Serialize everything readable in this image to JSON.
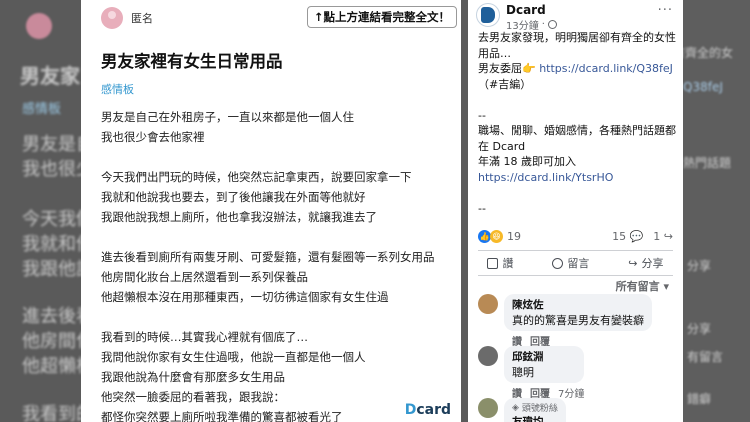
{
  "background": {
    "left_lines": [
      "男友家",
      "感情板",
      "男友是自",
      "我也很少",
      "今天我們",
      "我就和他",
      "我跟他說",
      "進去後看",
      "他房間化",
      "他超懶根",
      "我看到的"
    ],
    "right_lines": [
      "有齊全的女",
      "Q38feJ",
      "熱門話題",
      "分享",
      "分享",
      "有留言",
      "錯癖"
    ]
  },
  "article": {
    "author": "匿名",
    "notice": "↑點上方連結看完整全文！",
    "title": "男友家裡有女生日常用品",
    "tag": "感情板",
    "lines": [
      "男友是自己在外租房子，一直以來都是他一個人住",
      "我也很少會去他家裡",
      "",
      "今天我們出門玩的時候，他突然忘記拿東西，說要回家拿一下",
      "我就和他說我也要去，到了後他讓我在外面等他就好",
      "我跟他說我想上廁所，他也拿我沒辦法，就讓我進去了",
      "",
      "進去後看到廁所有兩隻牙刷、可愛髮箍，還有髮圈等一系列女用品",
      "他房間化妝台上居然還看到一系列保養品",
      "他超懶根本沒在用那種東西，一切彷彿這個家有女生住過",
      "",
      "我看到的時候…其實我心裡就有個底了…",
      "我問他說你家有女生住過哦，他說一直都是他一個人",
      "我跟他說為什麼會有那麼多女生用品",
      "他突然一臉委屈的看著我，跟我說：",
      "都怪你突然要上廁所啦我準備的驚喜都被看光了"
    ],
    "logo_d": "D",
    "logo_rest": "card"
  },
  "post": {
    "page_name": "Dcard",
    "time": "13分鐘",
    "more": "···",
    "text_lines": [
      "去男友家發現，明明獨居卻有齊全的女性用品…",
      "男友委屈👉 https://dcard.link/Q38feJ",
      "（#吉編）",
      "",
      "--",
      "職場、閒聊、婚姻感情，各種熱門話題都在 Dcard",
      "年滿 18 歲即可加入",
      "https://dcard.link/YtsrHO",
      "",
      "--"
    ],
    "reactions_count": "19",
    "comments_count": "15",
    "shares_count": "1",
    "actions": [
      "讚",
      "留言",
      "分享"
    ],
    "sort_label": "所有留言",
    "comments": [
      {
        "name": "陳炫佐",
        "text": "真的的驚喜是男友有變裝癖",
        "like": "讚",
        "reply": "回覆",
        "time": "",
        "color": "#b88a55"
      },
      {
        "name": "邱鉉淵",
        "text": "聰明",
        "like": "讚",
        "reply": "回覆",
        "time": "7分鐘",
        "color": "#6b6b6b"
      },
      {
        "name": "友瑋均",
        "text": "",
        "like": "",
        "reply": "",
        "time": "",
        "rank": "頭號粉絲",
        "color": "#8a8f6a"
      }
    ]
  }
}
